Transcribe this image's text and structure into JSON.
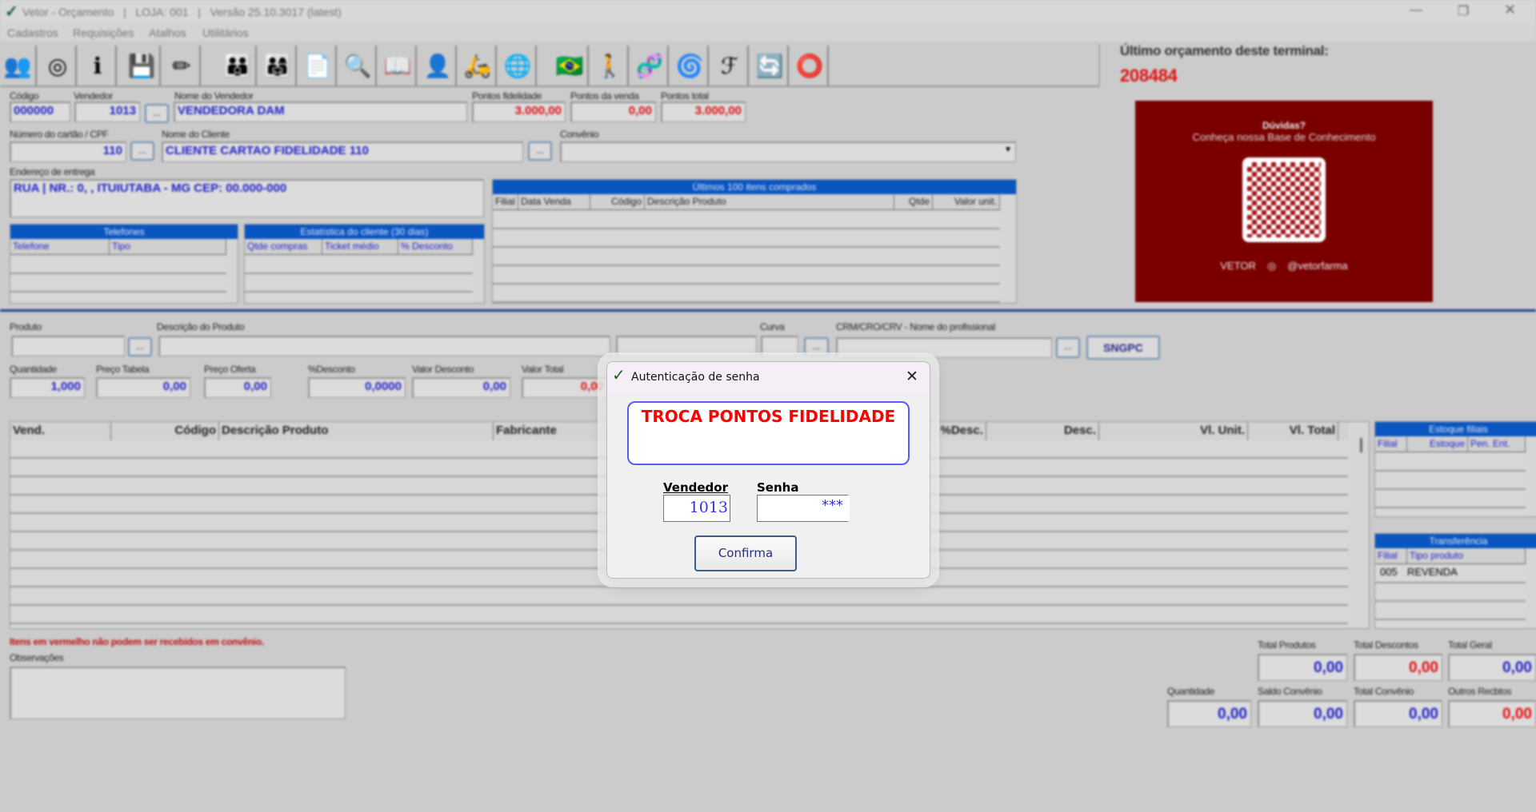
{
  "window": {
    "title": "Vetor - Orçamento",
    "loja": "LOJA: 001",
    "versao": "Versão 25.10.3017 (latest)",
    "sep": "|"
  },
  "menu": [
    "Cadastros",
    "Requisições",
    "Atalhos",
    "Utilitários"
  ],
  "toolbar": [
    {
      "icon": "add-user-icon",
      "g": "👥"
    },
    {
      "icon": "sync-icon",
      "g": "◎"
    },
    {
      "icon": "info-icon",
      "g": "ℹ"
    },
    {
      "icon": "save-icon",
      "g": "💾"
    },
    {
      "icon": "edit-icon",
      "g": "✏"
    },
    {
      "icon": "customers-icon",
      "g": "👪"
    },
    {
      "icon": "customer-card-icon",
      "g": "👨‍👩‍👧"
    },
    {
      "icon": "copy-document-icon",
      "g": "📄"
    },
    {
      "icon": "search-icon",
      "g": "🔍"
    },
    {
      "icon": "book-icon",
      "g": "📖"
    },
    {
      "icon": "person-icon",
      "g": "👤"
    },
    {
      "icon": "delivery-icon",
      "g": "🛵"
    },
    {
      "icon": "web-shop-icon",
      "g": "🌐"
    },
    {
      "icon": "brazil-flag-icon",
      "g": "🇧🇷"
    },
    {
      "icon": "accessibility-icon",
      "g": "🚶"
    },
    {
      "icon": "dna-icon",
      "g": "🧬"
    },
    {
      "icon": "spiral-icon",
      "g": "🌀"
    },
    {
      "icon": "lf-icon",
      "g": "ℱ"
    },
    {
      "icon": "refresh-icon",
      "g": "🔄"
    },
    {
      "icon": "circle-icon",
      "g": "⭕"
    }
  ],
  "last_budget": {
    "label": "Último orçamento deste terminal:",
    "value": "208484"
  },
  "promo": {
    "title": "Dúvidas?",
    "subtitle": "Conheça nossa Base de Conhecimento",
    "brand": "VETOR",
    "social": "@vetorfarma"
  },
  "form": {
    "codigo": {
      "label": "Código",
      "value": "000000"
    },
    "vendedor": {
      "label": "Vendedor",
      "value": "1013"
    },
    "nome_vendedor": {
      "label": "Nome do Vendedor",
      "value": "VENDEDORA DAM"
    },
    "pontos_fidelidade": {
      "label": "Pontos fidelidade",
      "value": "3.000,00"
    },
    "pontos_venda": {
      "label": "Pontos da venda",
      "value": "0,00"
    },
    "pontos_total": {
      "label": "Pontos total",
      "value": "3.000,00"
    },
    "cartao": {
      "label": "Número do cartão / CPF",
      "value": "110"
    },
    "nome_cliente": {
      "label": "Nome do Cliente",
      "value": "CLIENTE CARTAO FIDELIDADE 110"
    },
    "convenio": {
      "label": "Convênio",
      "value": ""
    },
    "endereco": {
      "label": "Endereço de entrega",
      "value": "RUA | NR.: 0, , ITUIUTABA - MG CEP: 00.000-000"
    },
    "dots": "..."
  },
  "telefones": {
    "title": "Telefones",
    "cols": [
      "Telefone",
      "Tipo"
    ]
  },
  "estatistica": {
    "title": "Estatística do cliente (30 dias)",
    "cols": [
      "Qtde compras",
      "Ticket médio",
      "% Desconto"
    ]
  },
  "ultimos": {
    "title": "Últimos 100 itens comprados",
    "cols": [
      "Filial",
      "Data Venda",
      "Código",
      "Descrição Produto",
      "Qtde",
      "Valor unit."
    ]
  },
  "produto": {
    "produto": "Produto",
    "descricao": "Descrição do Produto",
    "curva": "Curva",
    "crm": "CRM/CRO/CRV - Nome do profissional",
    "sngpc": "SNGPC"
  },
  "valores": [
    {
      "label": "Quantidade",
      "value": "1,000"
    },
    {
      "label": "Preço Tabela",
      "value": "0,00"
    },
    {
      "label": "Preço Oferta",
      "value": "0,00"
    },
    {
      "label": "%Desconto",
      "value": "0,0000"
    },
    {
      "label": "Valor Desconto",
      "value": "0,00"
    },
    {
      "label": "Valor Total",
      "value": "0,00"
    }
  ],
  "grid": {
    "cols": [
      "Vend.",
      "Código",
      "Descrição Produto",
      "Fabricante",
      "",
      "",
      "%Desc.",
      "Desc.",
      "Vl. Unit.",
      "Vl. Total"
    ]
  },
  "estoque": {
    "title": "Estoque filiais",
    "cols": [
      "Filial",
      "Estoque",
      "Pen. Ent."
    ]
  },
  "transferencia": {
    "title": "Transferência",
    "cols": [
      "Filial",
      "Tipo produto"
    ],
    "rows": [
      {
        "filial": "005",
        "tipo": "REVENDA"
      }
    ]
  },
  "note": "Itens em vermelho não podem ser recebidos em convênio.",
  "observacoes": "Observações",
  "totais": [
    {
      "label": "Total Produtos",
      "value": "0,00"
    },
    {
      "label": "Total Descontos",
      "value": "0,00"
    },
    {
      "label": "Total Geral",
      "value": "0,00"
    },
    {
      "label": "Quantidade",
      "value": "0,00"
    },
    {
      "label": "Saldo Convênio",
      "value": "0,00"
    },
    {
      "label": "Total Convênio",
      "value": "0,00"
    },
    {
      "label": "Outros Recbtos",
      "value": "0,00"
    }
  ],
  "dialog": {
    "title": "Autenticação de senha",
    "message": "TROCA PONTOS FIDELIDADE",
    "vendedor_label": "Vendedor",
    "vendedor_value": "1013",
    "senha_label": "Senha",
    "senha_value": "***",
    "confirm": "Confirma"
  }
}
